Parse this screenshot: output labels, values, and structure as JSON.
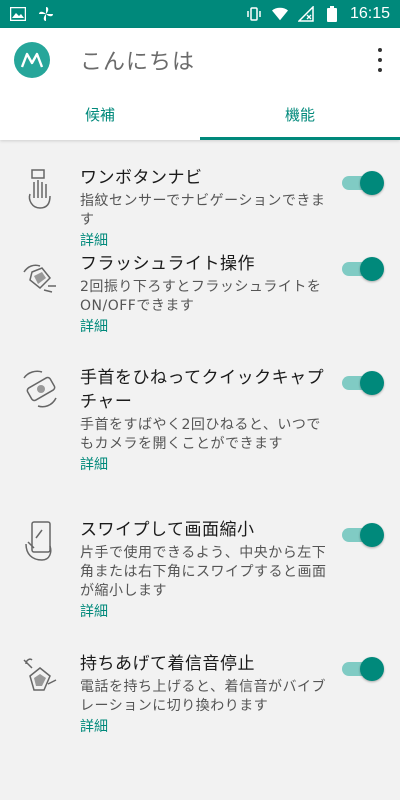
{
  "status_bar": {
    "time": "16:15",
    "left_icons": [
      "image-icon",
      "fan-icon"
    ],
    "right_icons": [
      "vibrate-icon",
      "wifi-icon",
      "no-signal-icon",
      "battery-icon"
    ]
  },
  "header": {
    "title": "こんにちは",
    "menu_icon": "more-vert-icon",
    "tabs": [
      {
        "label": "候補",
        "active": false
      },
      {
        "label": "機能",
        "active": true
      }
    ]
  },
  "features": [
    {
      "title": "ワンボタンナビ",
      "description": "指紋センサーでナビゲーションできます",
      "link": "詳細",
      "enabled": true,
      "icon": "fingerprint-hand-icon"
    },
    {
      "title": "フラッシュライト操作",
      "description": "2回振り下ろすとフラッシュライトをON/OFFできます",
      "link": "詳細",
      "enabled": true,
      "icon": "flashlight-chop-icon"
    },
    {
      "title": "手首をひねってクイックキャプチャー",
      "description": "手首をすばやく2回ひねると、いつでもカメラを開くことができます",
      "link": "詳細",
      "enabled": true,
      "icon": "twist-camera-icon"
    },
    {
      "title": "スワイプして画面縮小",
      "description": "片手で使用できるよう、中央から左下角または右下角にスワイプすると画面が縮小します",
      "link": "詳細",
      "enabled": true,
      "icon": "swipe-shrink-icon"
    },
    {
      "title": "持ちあげて着信音停止",
      "description": "電話を持ち上げると、着信音がバイブレーションに切り換わります",
      "link": "詳細",
      "enabled": true,
      "icon": "pickup-mute-icon"
    }
  ],
  "colors": {
    "accent": "#00897b",
    "status_bar": "#00897b",
    "toggle_track": "#80cbc4",
    "background": "#f2f2f2"
  }
}
